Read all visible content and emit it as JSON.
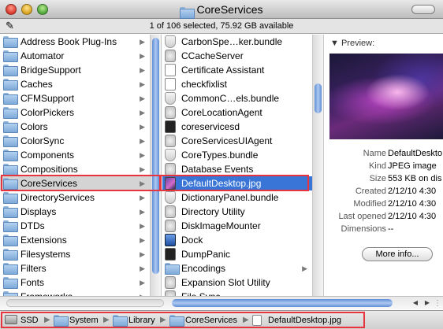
{
  "window": {
    "title": "CoreServices",
    "status": "1 of 106 selected, 75.92 GB available"
  },
  "column1": {
    "items": [
      {
        "label": "Address Book Plug-Ins",
        "type": "folder"
      },
      {
        "label": "Automator",
        "type": "folder"
      },
      {
        "label": "BridgeSupport",
        "type": "folder"
      },
      {
        "label": "Caches",
        "type": "folder"
      },
      {
        "label": "CFMSupport",
        "type": "folder"
      },
      {
        "label": "ColorPickers",
        "type": "folder"
      },
      {
        "label": "Colors",
        "type": "folder"
      },
      {
        "label": "ColorSync",
        "type": "folder"
      },
      {
        "label": "Components",
        "type": "folder"
      },
      {
        "label": "Compositions",
        "type": "folder"
      },
      {
        "label": "CoreServices",
        "type": "folder",
        "selected": true
      },
      {
        "label": "DirectoryServices",
        "type": "folder"
      },
      {
        "label": "Displays",
        "type": "folder"
      },
      {
        "label": "DTDs",
        "type": "folder"
      },
      {
        "label": "Extensions",
        "type": "folder"
      },
      {
        "label": "Filesystems",
        "type": "folder"
      },
      {
        "label": "Filters",
        "type": "folder"
      },
      {
        "label": "Fonts",
        "type": "folder"
      },
      {
        "label": "Frameworks",
        "type": "folder"
      }
    ]
  },
  "column2": {
    "items": [
      {
        "label": "CarbonSpe…ker.bundle",
        "icon": "bundle-icon"
      },
      {
        "label": "CCacheServer",
        "icon": "app-icon"
      },
      {
        "label": "Certificate Assistant",
        "icon": "certificate-icon"
      },
      {
        "label": "checkfixlist",
        "icon": "document-icon"
      },
      {
        "label": "CommonC…els.bundle",
        "icon": "bundle-icon"
      },
      {
        "label": "CoreLocationAgent",
        "icon": "app-icon"
      },
      {
        "label": "coreservicesd",
        "icon": "terminal-icon"
      },
      {
        "label": "CoreServicesUIAgent",
        "icon": "app-icon"
      },
      {
        "label": "CoreTypes.bundle",
        "icon": "bundle-icon"
      },
      {
        "label": "Database Events",
        "icon": "app-icon"
      },
      {
        "label": "DefaultDesktop.jpg",
        "icon": "image-icon",
        "selected": true
      },
      {
        "label": "DictionaryPanel.bundle",
        "icon": "bundle-icon"
      },
      {
        "label": "Directory Utility",
        "icon": "app-icon"
      },
      {
        "label": "DiskImageMounter",
        "icon": "app-icon"
      },
      {
        "label": "Dock",
        "icon": "dock-icon"
      },
      {
        "label": "DumpPanic",
        "icon": "terminal-icon"
      },
      {
        "label": "Encodings",
        "icon": "folder-icon",
        "folder": true
      },
      {
        "label": "Expansion Slot Utility",
        "icon": "app-icon"
      },
      {
        "label": "File Sync",
        "icon": "app-icon"
      }
    ]
  },
  "preview": {
    "title": "Preview:",
    "fields": [
      {
        "key": "Name",
        "value": "DefaultDeskto"
      },
      {
        "key": "Kind",
        "value": "JPEG image"
      },
      {
        "key": "Size",
        "value": "553 KB on dis"
      },
      {
        "key": "Created",
        "value": "2/12/10 4:30"
      },
      {
        "key": "Modified",
        "value": "2/12/10 4:30"
      },
      {
        "key": "Last opened",
        "value": "2/12/10 4:30"
      },
      {
        "key": "Dimensions",
        "value": "--"
      }
    ],
    "more_info_label": "More info..."
  },
  "pathbar": {
    "crumbs": [
      "SSD",
      "System",
      "Library",
      "CoreServices",
      "DefaultDesktop.jpg"
    ]
  },
  "colors": {
    "selection_blue": "#3875d7",
    "highlight_red": "#e8343f"
  }
}
